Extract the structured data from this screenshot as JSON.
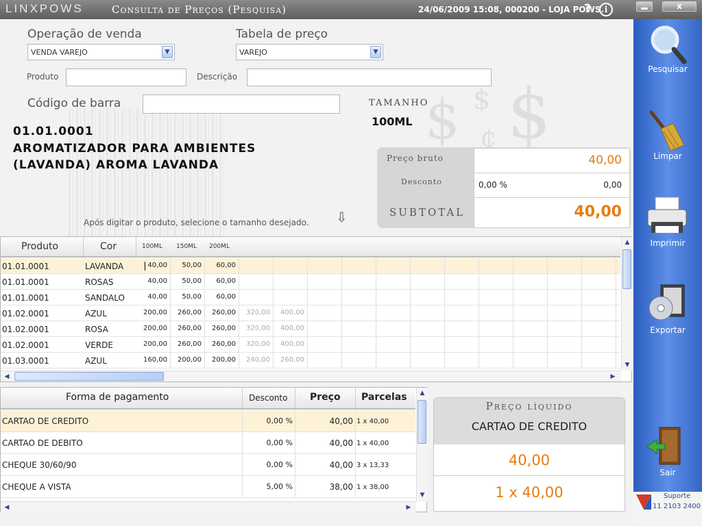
{
  "titlebar": {
    "brand": "LINXPOWS",
    "title": "Consulta de Preços (Pesquisa)",
    "datetime": "24/06/2009 15:08, 000200 - LOJA POWS.",
    "help": "?",
    "info": "i",
    "close": "x"
  },
  "form": {
    "operacao_label": "Operação de venda",
    "operacao_value": "VENDA VAREJO",
    "tabela_label": "Tabela de preço",
    "tabela_value": "VAREJO",
    "produto_label": "Produto",
    "produto_value": "",
    "descricao_label": "Descrição",
    "descricao_value": "",
    "barra_label": "Código de barra",
    "barra_value": "",
    "tamanho_label": "TAMANHO",
    "tamanho_value": "100ML"
  },
  "product": {
    "code": "01.01.0001",
    "description": "AROMATIZADOR PARA AMBIENTES (LAVANDA) AROMA LAVANDA"
  },
  "hint": "Após digitar o produto, selecione o tamanho desejado.",
  "prices": {
    "bruto_label": "Preço bruto",
    "bruto_value": "40,00",
    "desconto_label": "Desconto",
    "desconto_pct": "0,00 %",
    "desconto_value": "0,00",
    "subtotal_label": "SUBTOTAL",
    "subtotal_value": "40,00"
  },
  "grid1": {
    "headers": [
      "Produto",
      "Cor",
      "100ML",
      "150ML",
      "200ML"
    ],
    "rows": [
      {
        "produto": "01.01.0001",
        "cor": "LAVANDA",
        "v": [
          "40,00",
          "50,00",
          "60,00",
          "",
          ""
        ]
      },
      {
        "produto": "01.01.0001",
        "cor": "ROSAS",
        "v": [
          "40,00",
          "50,00",
          "60,00",
          "",
          ""
        ]
      },
      {
        "produto": "01.01.0001",
        "cor": "SANDALO",
        "v": [
          "40,00",
          "50,00",
          "60,00",
          "",
          ""
        ]
      },
      {
        "produto": "01.02.0001",
        "cor": "AZUL",
        "v": [
          "200,00",
          "260,00",
          "260,00",
          "320,00",
          "400,00"
        ]
      },
      {
        "produto": "01.02.0001",
        "cor": "ROSA",
        "v": [
          "200,00",
          "260,00",
          "260,00",
          "320,00",
          "400,00"
        ]
      },
      {
        "produto": "01.02.0001",
        "cor": "VERDE",
        "v": [
          "200,00",
          "260,00",
          "260,00",
          "320,00",
          "400,00"
        ]
      },
      {
        "produto": "01.03.0001",
        "cor": "AZUL",
        "v": [
          "160,00",
          "200,00",
          "200,00",
          "240,00",
          "260,00"
        ]
      }
    ]
  },
  "grid2": {
    "headers": [
      "Forma de pagamento",
      "Desconto",
      "Preço",
      "Parcelas"
    ],
    "rows": [
      {
        "forma": "CARTAO DE CREDITO",
        "desconto": "0,00 %",
        "preco": "40,00",
        "parcelas": "1 x 40,00"
      },
      {
        "forma": "CARTAO DE DEBITO",
        "desconto": "0,00 %",
        "preco": "40,00",
        "parcelas": "1 x 40,00"
      },
      {
        "forma": "CHEQUE 30/60/90",
        "desconto": "0,00 %",
        "preco": "40,00",
        "parcelas": "3 x 13,33"
      },
      {
        "forma": "CHEQUE A VISTA",
        "desconto": "5,00 %",
        "preco": "38,00",
        "parcelas": "1 x 38,00"
      }
    ]
  },
  "liquido": {
    "title": "Preço líquido",
    "forma": "CARTAO DE CREDITO",
    "valor": "40,00",
    "parcelas": "1 x 40,00"
  },
  "sidebar": {
    "pesquisar": "Pesquisar",
    "limpar": "Limpar",
    "imprimir": "Imprimir",
    "exportar": "Exportar",
    "sair": "Sair"
  },
  "support": {
    "label": "Suporte",
    "phone": "11 2103 2400"
  },
  "colors": {
    "accent_orange": "#e87c0e",
    "sidebar_blue": "#3b6fd4",
    "selected_row": "#fdf2d8"
  }
}
